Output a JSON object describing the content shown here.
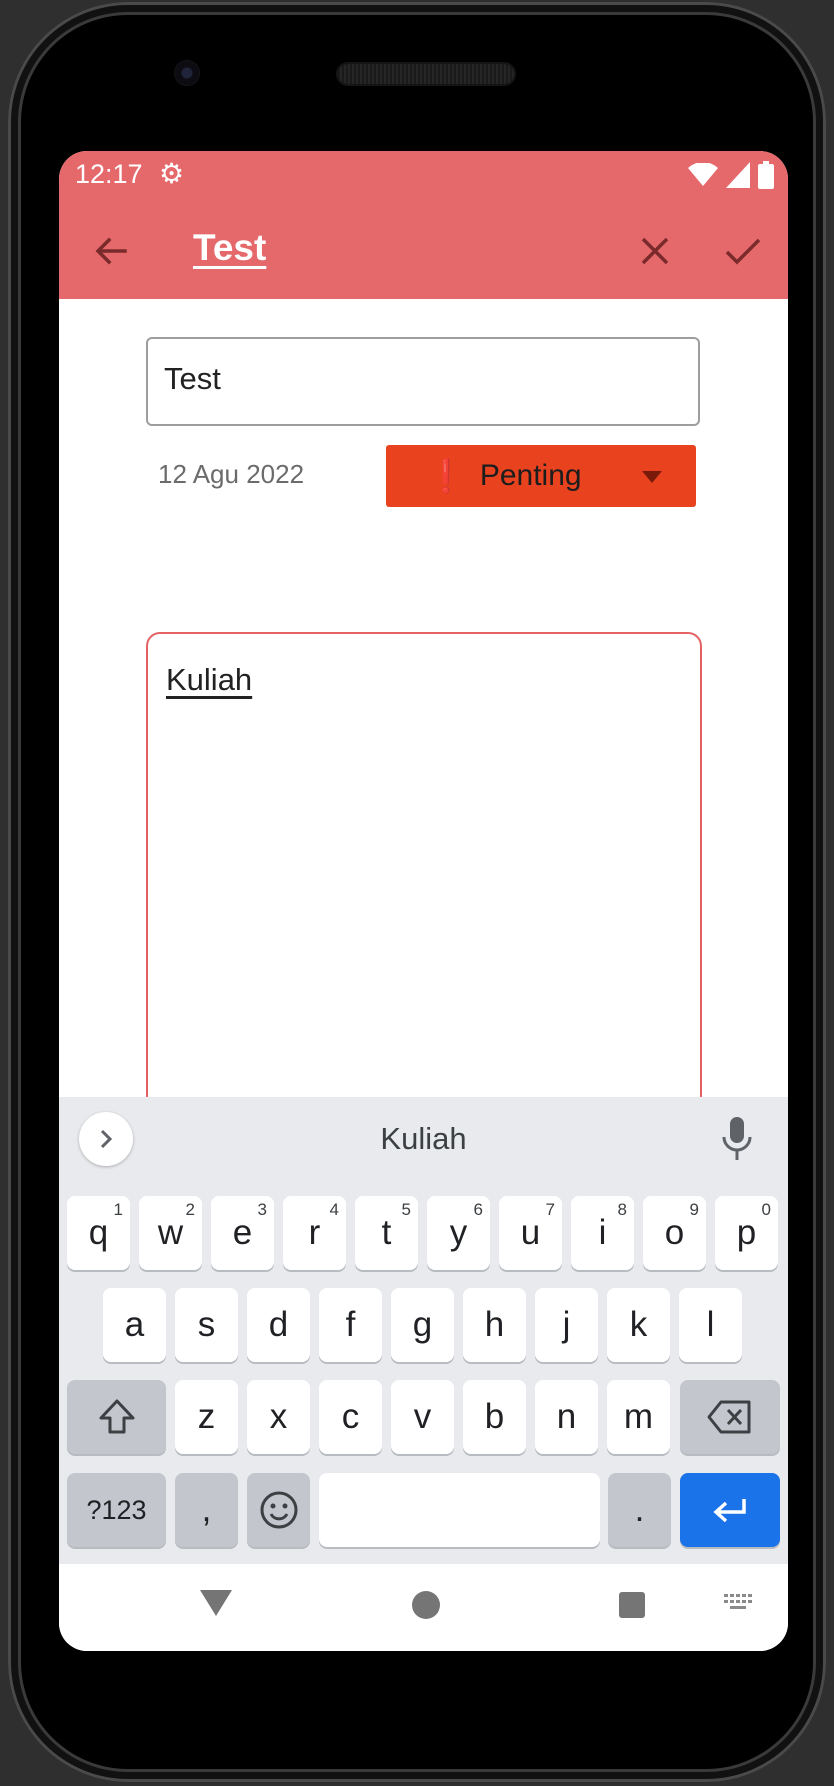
{
  "status_bar": {
    "time": "12:17",
    "icons": [
      "settings-icon",
      "wifi-icon",
      "signal-icon",
      "battery-icon"
    ]
  },
  "app_bar": {
    "title": "Test",
    "back_icon": "arrow-back-icon",
    "close_icon": "close-icon",
    "confirm_icon": "check-icon",
    "color": "#e5686b"
  },
  "form": {
    "title_value": "Test",
    "date": "12 Agu 2022",
    "priority": {
      "icon": "❗",
      "label": "Penting",
      "color": "#e8421f"
    },
    "description_value": "Kuliah"
  },
  "keyboard": {
    "suggestion": "Kuliah",
    "rows": [
      [
        {
          "k": "q",
          "h": "1"
        },
        {
          "k": "w",
          "h": "2"
        },
        {
          "k": "e",
          "h": "3"
        },
        {
          "k": "r",
          "h": "4"
        },
        {
          "k": "t",
          "h": "5"
        },
        {
          "k": "y",
          "h": "6"
        },
        {
          "k": "u",
          "h": "7"
        },
        {
          "k": "i",
          "h": "8"
        },
        {
          "k": "o",
          "h": "9"
        },
        {
          "k": "p",
          "h": "0"
        }
      ],
      [
        {
          "k": "a"
        },
        {
          "k": "s"
        },
        {
          "k": "d"
        },
        {
          "k": "f"
        },
        {
          "k": "g"
        },
        {
          "k": "h"
        },
        {
          "k": "j"
        },
        {
          "k": "k"
        },
        {
          "k": "l"
        }
      ],
      [
        {
          "k": "z"
        },
        {
          "k": "x"
        },
        {
          "k": "c"
        },
        {
          "k": "v"
        },
        {
          "k": "b"
        },
        {
          "k": "n"
        },
        {
          "k": "m"
        }
      ]
    ],
    "symbols_label": "?123",
    "comma_label": ",",
    "period_label": ".",
    "enter_color": "#1a73e8"
  },
  "nav_bar": {
    "icons": [
      "nav-back-icon",
      "nav-home-icon",
      "nav-recents-icon",
      "keyboard-switch-icon"
    ]
  }
}
